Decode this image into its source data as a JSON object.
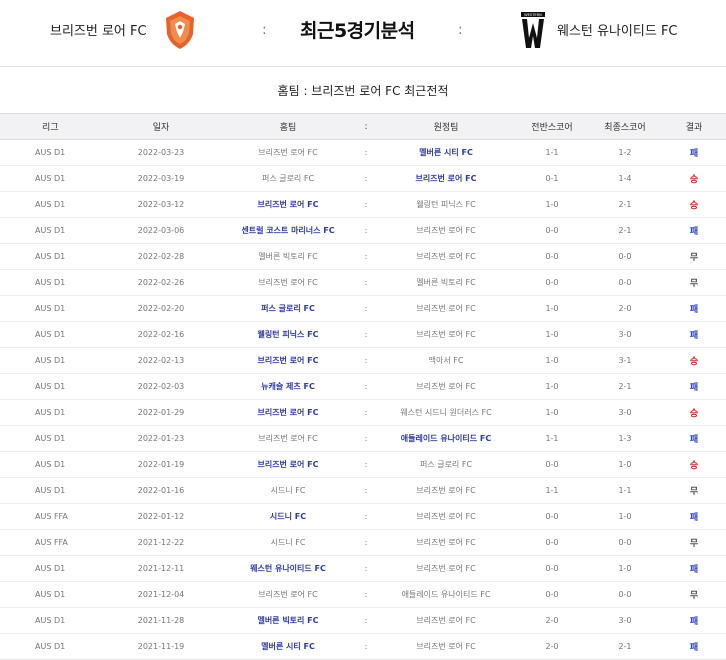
{
  "header": {
    "home_team": "브리즈번 로어 FC",
    "separator": ":",
    "title": "최근5경기분석",
    "away_team": "웨스턴 유나이티드 FC",
    "away_logo_text": "WESTERN"
  },
  "subtitle": "홈팀 : 브리즈번 로어 FC 최근전적",
  "colors": {
    "winner_team": "#2e3aa8",
    "loss": "#2b44c8",
    "win": "#d42020",
    "draw": "#555555",
    "home_logo": "#e9602a",
    "away_logo": "#111111"
  },
  "table": {
    "headers": [
      "리그",
      "일자",
      "홈팀",
      ":",
      "원정팀",
      "전반스코어",
      "최종스코어",
      "결과"
    ],
    "rows": [
      {
        "league": "AUS D1",
        "date": "2022-03-23",
        "home": "브리즈번 로어 FC",
        "sep": ":",
        "away": "멜버른 시티 FC",
        "half": "1-1",
        "final": "1-2",
        "result": "패",
        "winner": "away",
        "rtype": "L"
      },
      {
        "league": "AUS D1",
        "date": "2022-03-19",
        "home": "퍼스 글로리 FC",
        "sep": ":",
        "away": "브리즈번 로어 FC",
        "half": "0-1",
        "final": "1-4",
        "result": "승",
        "winner": "away",
        "rtype": "W"
      },
      {
        "league": "AUS D1",
        "date": "2022-03-12",
        "home": "브리즈번 로어 FC",
        "sep": ":",
        "away": "웰링턴 피닉스 FC",
        "half": "1-0",
        "final": "2-1",
        "result": "승",
        "winner": "home",
        "rtype": "W"
      },
      {
        "league": "AUS D1",
        "date": "2022-03-06",
        "home": "센트럴 코스트 마리너스 FC",
        "sep": ":",
        "away": "브리즈번 로어 FC",
        "half": "0-0",
        "final": "2-1",
        "result": "패",
        "winner": "home",
        "rtype": "L"
      },
      {
        "league": "AUS D1",
        "date": "2022-02-28",
        "home": "멜버른 빅토리 FC",
        "sep": ":",
        "away": "브리즈번 로어 FC",
        "half": "0-0",
        "final": "0-0",
        "result": "무",
        "winner": "none",
        "rtype": "D"
      },
      {
        "league": "AUS D1",
        "date": "2022-02-26",
        "home": "브리즈번 로어 FC",
        "sep": ":",
        "away": "멜버른 빅토리 FC",
        "half": "0-0",
        "final": "0-0",
        "result": "무",
        "winner": "none",
        "rtype": "D"
      },
      {
        "league": "AUS D1",
        "date": "2022-02-20",
        "home": "퍼스 글로리 FC",
        "sep": ":",
        "away": "브리즈번 로어 FC",
        "half": "1-0",
        "final": "2-0",
        "result": "패",
        "winner": "home",
        "rtype": "L"
      },
      {
        "league": "AUS D1",
        "date": "2022-02-16",
        "home": "웰링턴 피닉스 FC",
        "sep": ":",
        "away": "브리즈번 로어 FC",
        "half": "1-0",
        "final": "3-0",
        "result": "패",
        "winner": "home",
        "rtype": "L"
      },
      {
        "league": "AUS D1",
        "date": "2022-02-13",
        "home": "브리즈번 로어 FC",
        "sep": ":",
        "away": "맥아서 FC",
        "half": "1-0",
        "final": "3-1",
        "result": "승",
        "winner": "home",
        "rtype": "W"
      },
      {
        "league": "AUS D1",
        "date": "2022-02-03",
        "home": "뉴캐슬 제츠 FC",
        "sep": ":",
        "away": "브리즈번 로어 FC",
        "half": "1-0",
        "final": "2-1",
        "result": "패",
        "winner": "home",
        "rtype": "L"
      },
      {
        "league": "AUS D1",
        "date": "2022-01-29",
        "home": "브리즈번 로어 FC",
        "sep": ":",
        "away": "웨스턴 시드니 원더러스 FC",
        "half": "1-0",
        "final": "3-0",
        "result": "승",
        "winner": "home",
        "rtype": "W"
      },
      {
        "league": "AUS D1",
        "date": "2022-01-23",
        "home": "브리즈번 로어 FC",
        "sep": ":",
        "away": "애들레이드 유나이티드 FC",
        "half": "1-1",
        "final": "1-3",
        "result": "패",
        "winner": "away",
        "rtype": "L"
      },
      {
        "league": "AUS D1",
        "date": "2022-01-19",
        "home": "브리즈번 로어 FC",
        "sep": ":",
        "away": "퍼스 글로리 FC",
        "half": "0-0",
        "final": "1-0",
        "result": "승",
        "winner": "home",
        "rtype": "W"
      },
      {
        "league": "AUS D1",
        "date": "2022-01-16",
        "home": "시드니 FC",
        "sep": ":",
        "away": "브리즈번 로어 FC",
        "half": "1-1",
        "final": "1-1",
        "result": "무",
        "winner": "none",
        "rtype": "D"
      },
      {
        "league": "AUS FFA",
        "date": "2022-01-12",
        "home": "시드니 FC",
        "sep": ":",
        "away": "브리즈번 로어 FC",
        "half": "0-0",
        "final": "1-0",
        "result": "패",
        "winner": "home",
        "rtype": "L"
      },
      {
        "league": "AUS FFA",
        "date": "2021-12-22",
        "home": "시드니 FC",
        "sep": ":",
        "away": "브리즈번 로어 FC",
        "half": "0-0",
        "final": "0-0",
        "result": "무",
        "winner": "none",
        "rtype": "D"
      },
      {
        "league": "AUS D1",
        "date": "2021-12-11",
        "home": "웨스턴 유나이티드 FC",
        "sep": ":",
        "away": "브리즈번 로어 FC",
        "half": "0-0",
        "final": "1-0",
        "result": "패",
        "winner": "home",
        "rtype": "L"
      },
      {
        "league": "AUS D1",
        "date": "2021-12-04",
        "home": "브리즈번 로어 FC",
        "sep": ":",
        "away": "애들레이드 유나이티드 FC",
        "half": "0-0",
        "final": "0-0",
        "result": "무",
        "winner": "none",
        "rtype": "D"
      },
      {
        "league": "AUS D1",
        "date": "2021-11-28",
        "home": "멜버른 빅토리 FC",
        "sep": ":",
        "away": "브리즈번 로어 FC",
        "half": "2-0",
        "final": "3-0",
        "result": "패",
        "winner": "home",
        "rtype": "L"
      },
      {
        "league": "AUS D1",
        "date": "2021-11-19",
        "home": "멜버른 시티 FC",
        "sep": ":",
        "away": "브리즈번 로어 FC",
        "half": "2-0",
        "final": "2-1",
        "result": "패",
        "winner": "home",
        "rtype": "L"
      }
    ]
  }
}
